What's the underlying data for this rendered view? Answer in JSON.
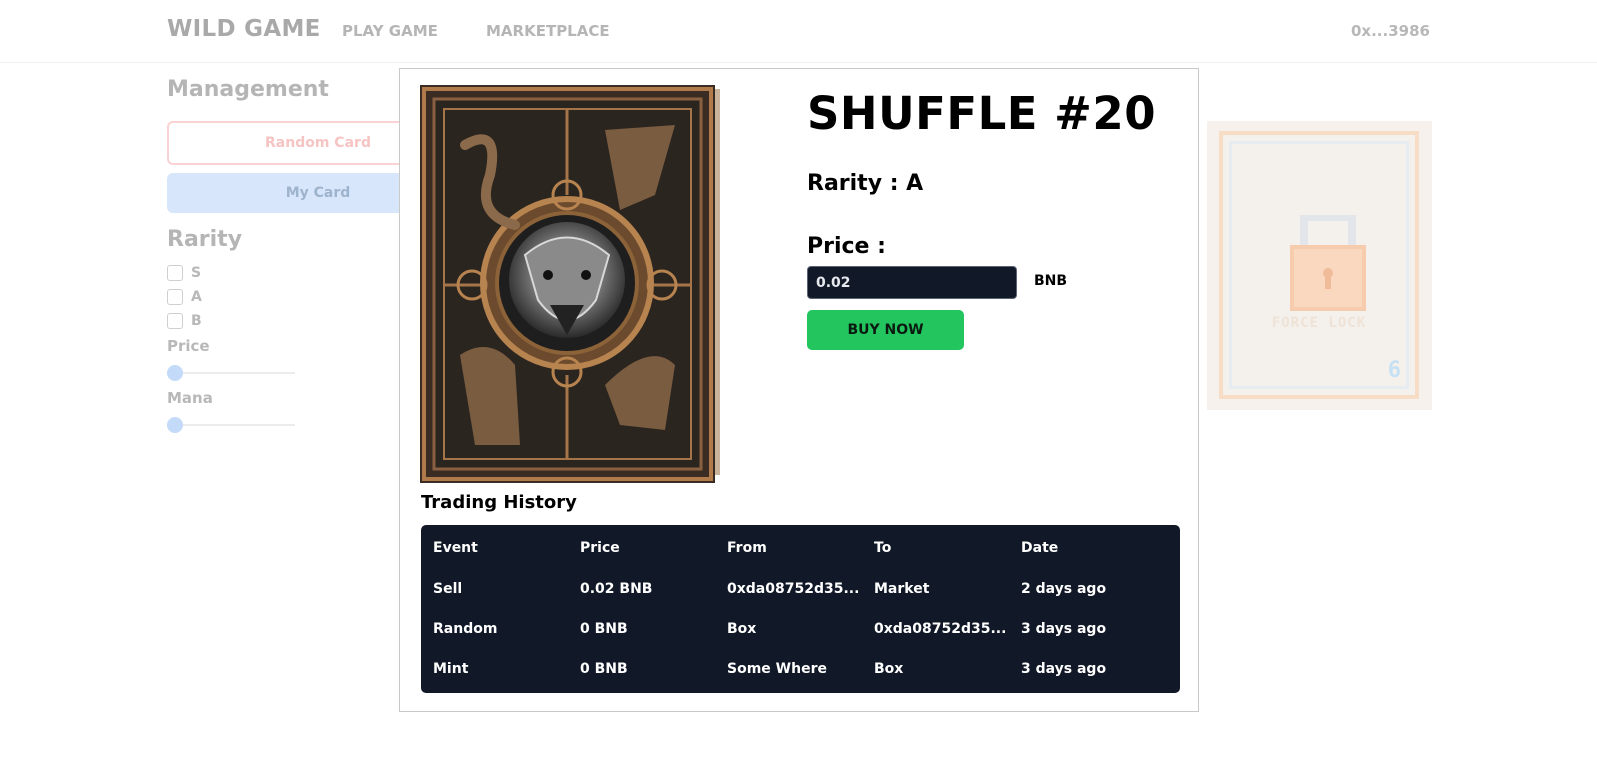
{
  "header": {
    "brand": "WILD GAME",
    "nav": {
      "play": "PLAY GAME",
      "marketplace": "MARKETPLACE"
    },
    "wallet": "0x...3986"
  },
  "sidebar": {
    "title": "Management",
    "random_card_label": "Random Card",
    "my_card_label": "My Card",
    "rarity_title": "Rarity",
    "rarity_options": [
      "S",
      "A",
      "B"
    ],
    "price_label": "Price",
    "mana_label": "Mana"
  },
  "background_card": {
    "lock_text": "FORCE LOCK",
    "mana": "6"
  },
  "modal": {
    "title": "SHUFFLE #20",
    "rarity_text": "Rarity : A",
    "price_label": "Price :",
    "price_value": "0.02",
    "currency": "BNB",
    "buy_label": "BUY NOW",
    "history_title": "Trading History",
    "history": {
      "columns": [
        "Event",
        "Price",
        "From",
        "To",
        "Date"
      ],
      "rows": [
        [
          "Sell",
          "0.02 BNB",
          "0xda08752d35...",
          "Market",
          "2 days ago"
        ],
        [
          "Random",
          "0 BNB",
          "Box",
          "0xda08752d35...",
          "3 days ago"
        ],
        [
          "Mint",
          "0 BNB",
          "Some Where",
          "Box",
          "3 days ago"
        ]
      ]
    }
  },
  "colors": {
    "buy_button": "#22c55e",
    "table_bg": "#111827",
    "input_bg": "#111827"
  }
}
